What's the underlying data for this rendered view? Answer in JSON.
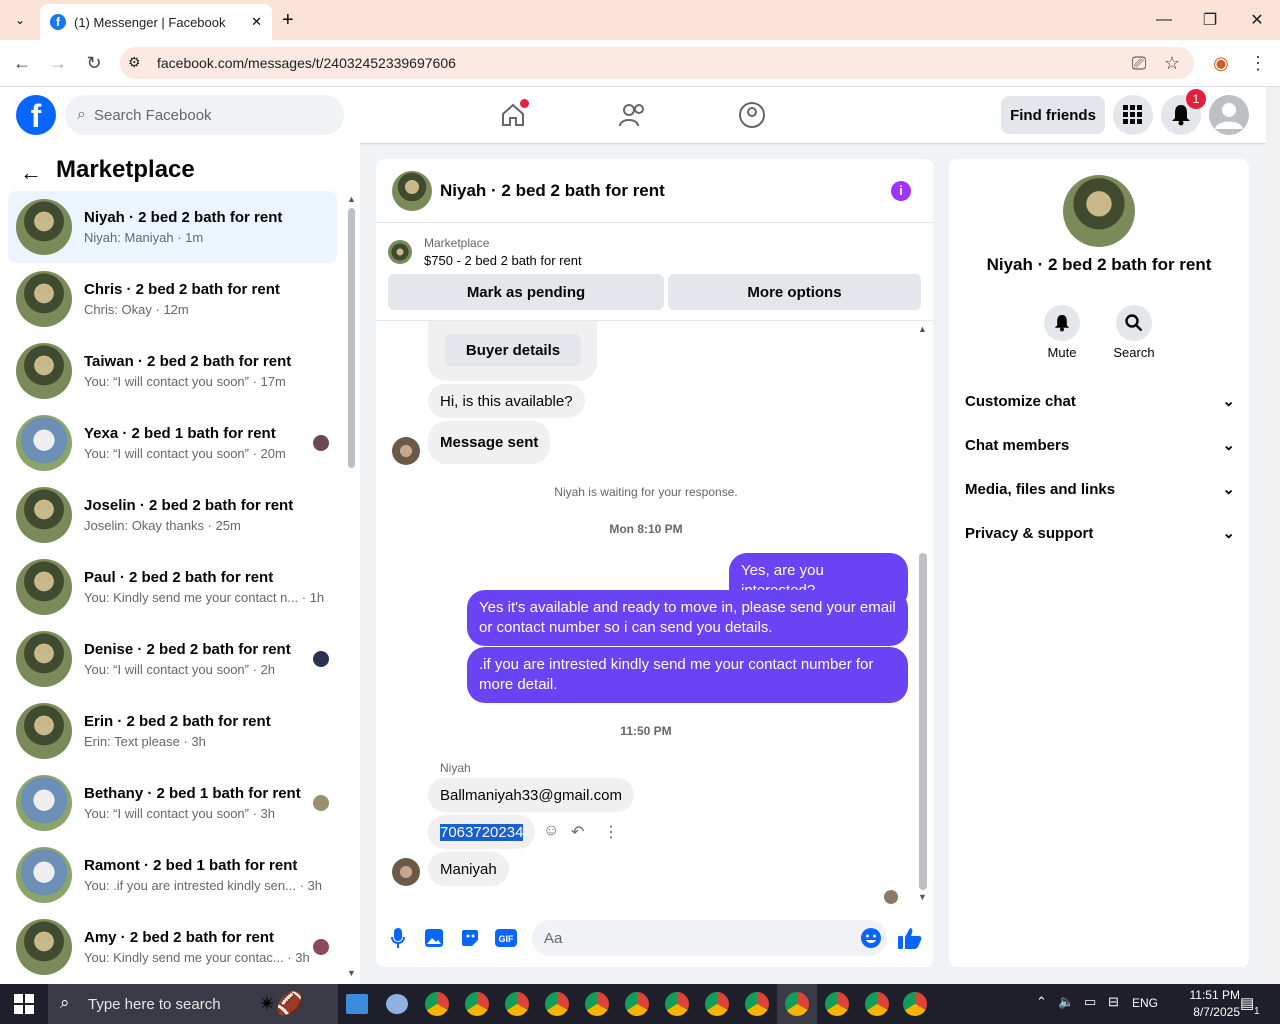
{
  "browser": {
    "tab_title": "(1) Messenger | Facebook",
    "url": "facebook.com/messages/t/24032452339697606"
  },
  "fb": {
    "logo": "f",
    "search_placeholder": "Search Facebook",
    "find_friends": "Find friends",
    "notification_count": "1"
  },
  "left": {
    "title": "Marketplace",
    "conversations": [
      {
        "name": "Niyah · 2 bed 2 bath for rent",
        "sub": "Niyah: Maniyah · 1m"
      },
      {
        "name": "Chris · 2 bed 2 bath for rent",
        "sub": "Chris: Okay · 12m"
      },
      {
        "name": "Taiwan · 2 bed 2 bath for rent",
        "sub": "You: “I will contact you soon” · 17m"
      },
      {
        "name": "Yexa · 2 bed 1 bath for rent",
        "sub": "You: “I will contact you soon” · 20m"
      },
      {
        "name": "Joselin · 2 bed 2 bath for rent",
        "sub": "Joselin: Okay thanks · 25m"
      },
      {
        "name": "Paul · 2 bed 2 bath for rent",
        "sub": "You: Kindly send me your contact n... · 1h"
      },
      {
        "name": "Denise · 2 bed 2 bath for rent",
        "sub": "You: “I will contact you soon” · 2h"
      },
      {
        "name": "Erin · 2 bed 2 bath for rent",
        "sub": "Erin: Text please · 3h"
      },
      {
        "name": "Bethany · 2 bed 1 bath for rent",
        "sub": "You: “I will contact you soon” · 3h"
      },
      {
        "name": "Ramont · 2 bed 1 bath for rent",
        "sub": "You: .if you are intrested kindly sen... · 3h"
      },
      {
        "name": "Amy · 2 bed 2 bath for rent",
        "sub": "You: Kindly send me your contac... · 3h"
      }
    ]
  },
  "chat": {
    "title": "Niyah · 2 bed 2 bath for rent",
    "mk_label": "Marketplace",
    "mk_listing": "$750 - 2 bed 2 bath for rent",
    "mark_pending": "Mark as pending",
    "more_options": "More options",
    "buyer_details": "Buyer details",
    "msg_available": "Hi, is this available?",
    "msg_sent": "Message sent",
    "waiting": "Niyah is waiting for your response.",
    "time1": "Mon 8:10 PM",
    "me1": "Yes, are you interested?",
    "me2": "Yes it's available and ready to move in, please send your email or contact number so i can send you details.",
    "me3": ".if you are intrested kindly send me your contact number for more detail.",
    "time2": "11:50 PM",
    "sender": "Niyah",
    "in1": "Ballmaniyah33@gmail.com",
    "in2": "7063720234",
    "in3": "Maniyah",
    "composer_placeholder": "Aa"
  },
  "right": {
    "name": "Niyah · 2 bed 2 bath for rent",
    "mute": "Mute",
    "search": "Search",
    "sections": [
      "Customize chat",
      "Chat members",
      "Media, files and links",
      "Privacy & support"
    ]
  },
  "taskbar": {
    "search_placeholder": "Type here to search",
    "lang": "ENG",
    "time": "11:51 PM",
    "date": "8/7/2025",
    "notif": "1"
  },
  "colors": {
    "accent": "#0866ff",
    "outgoing": "#6a43f5",
    "badge": "#e41e3f"
  }
}
